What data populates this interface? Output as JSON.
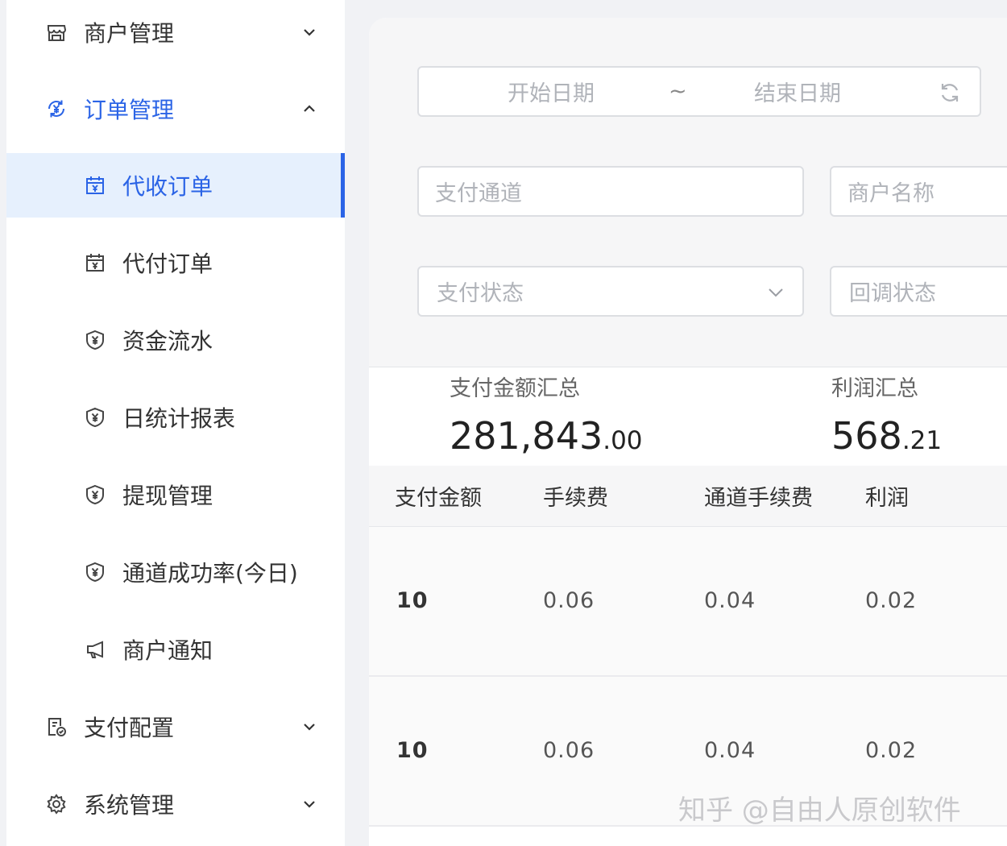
{
  "sidebar": {
    "items": [
      {
        "label": "商户管理",
        "icon": "storefront-icon",
        "expanded": false
      },
      {
        "label": "订单管理",
        "icon": "yen-cycle-icon",
        "expanded": true,
        "selected_group": true
      },
      {
        "label": "代收订单",
        "icon": "yen-calendar-icon",
        "active": true
      },
      {
        "label": "代付订单",
        "icon": "yen-calendar-icon"
      },
      {
        "label": "资金流水",
        "icon": "yen-shield-icon"
      },
      {
        "label": "日统计报表",
        "icon": "yen-shield-icon"
      },
      {
        "label": "提现管理",
        "icon": "yen-shield-icon"
      },
      {
        "label": "通道成功率(今日)",
        "icon": "yen-shield-icon"
      },
      {
        "label": "商户通知",
        "icon": "megaphone-icon"
      },
      {
        "label": "支付配置",
        "icon": "settings-doc-icon",
        "expanded": false
      },
      {
        "label": "系统管理",
        "icon": "gear-icon",
        "expanded": false
      }
    ],
    "accent_color": "#2b64e6"
  },
  "filters": {
    "start_date_placeholder": "开始日期",
    "range_separator": "~",
    "end_date_placeholder": "结束日期",
    "pay_channel_placeholder": "支付通道",
    "merchant_name_placeholder": "商户名称",
    "pay_status_placeholder": "支付状态",
    "callback_status_placeholder": "回调状态"
  },
  "summary": {
    "pay_amount_label": "支付金额汇总",
    "pay_amount_int": "281,843",
    "pay_amount_dec": ".00",
    "profit_label": "利润汇总",
    "profit_int": "568",
    "profit_dec": ".21"
  },
  "table": {
    "columns": [
      "支付金额",
      "手续费",
      "通道手续费",
      "利润"
    ],
    "rows": [
      [
        "10",
        "0.06",
        "0.04",
        "0.02"
      ],
      [
        "10",
        "0.06",
        "0.04",
        "0.02"
      ]
    ]
  },
  "watermark": "知乎 @自由人原创软件"
}
